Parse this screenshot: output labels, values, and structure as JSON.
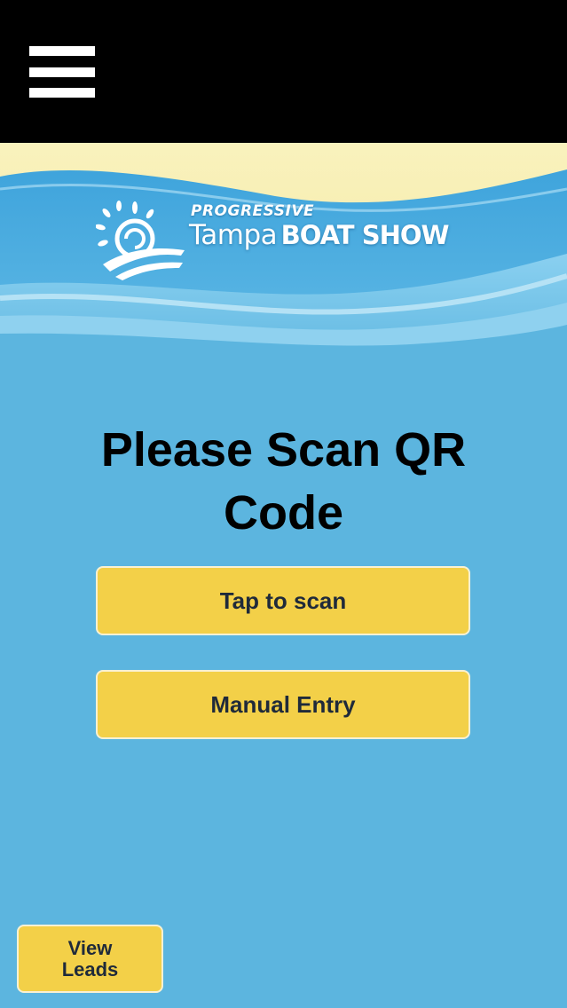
{
  "header": {
    "menu_icon": "hamburger-menu-icon"
  },
  "logo": {
    "sponsor": "PROGRESSIVE",
    "name_light": "Tampa",
    "name_bold": "BOAT SHOW",
    "mark_icon": "sun-wave-logo-icon"
  },
  "main": {
    "title": "Please Scan QR Code",
    "scan_label": "Tap to scan",
    "manual_label": "Manual Entry"
  },
  "footer": {
    "view_leads_line1": "View",
    "view_leads_line2": "Leads"
  },
  "colors": {
    "top_bar": "#000000",
    "background": "#5cb5df",
    "sand": "#f8eeae",
    "button": "#f3d048",
    "button_text": "#1f2a3a"
  }
}
